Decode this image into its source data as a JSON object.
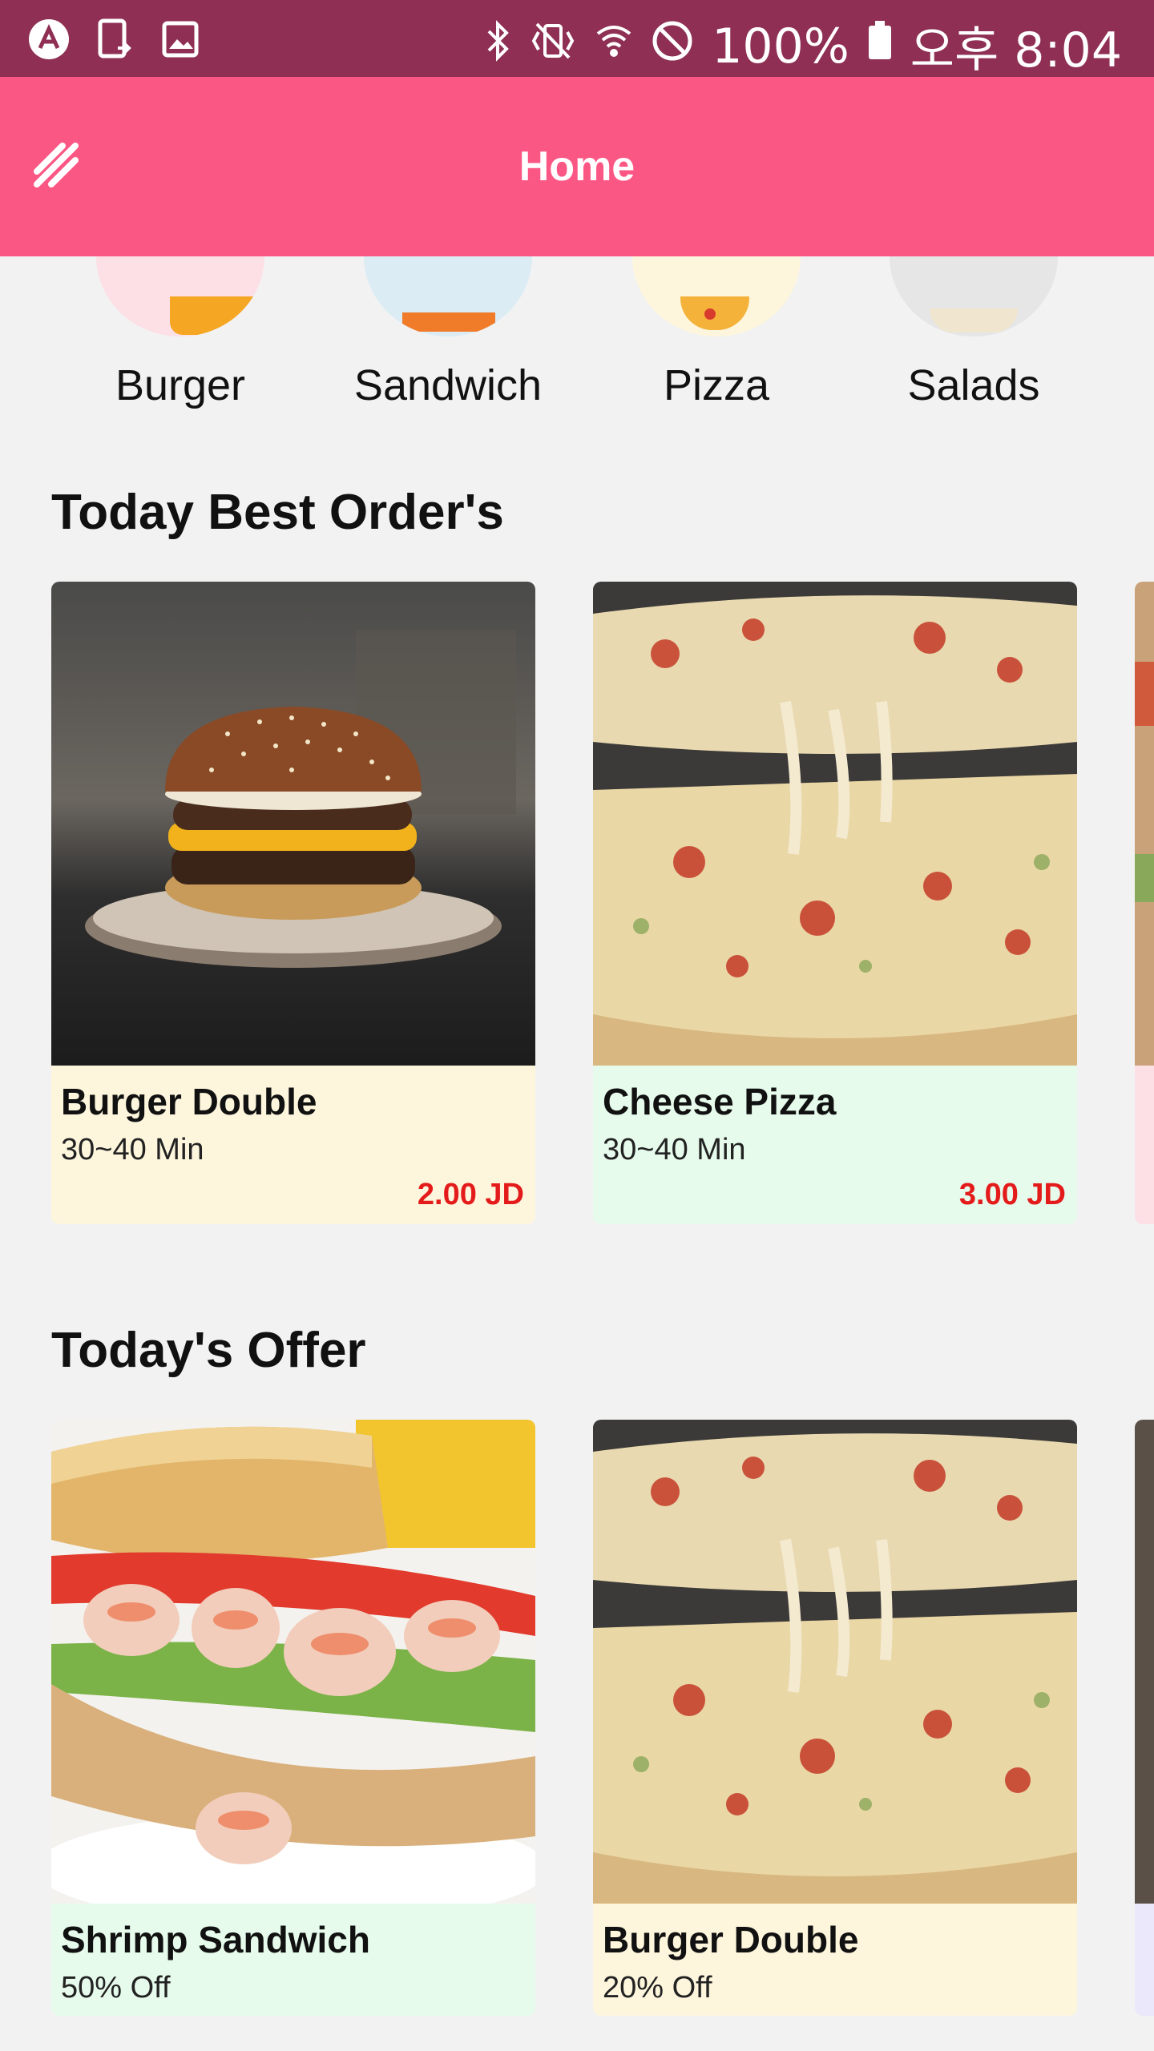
{
  "status_bar": {
    "left_icons": [
      "app-icon",
      "phone-transfer-icon",
      "image-icon"
    ],
    "right_icons": [
      "bluetooth-icon",
      "vibrate-icon",
      "wifi-icon",
      "do-not-disturb-icon",
      "battery-icon"
    ],
    "battery": "100%",
    "time": "오후 8:04"
  },
  "app_bar": {
    "title": "Home",
    "menu_icon": "menu-icon"
  },
  "categories": [
    {
      "label": "Burger",
      "color": "#fde0e6"
    },
    {
      "label": "Sandwich",
      "color": "#dcecf5"
    },
    {
      "label": "Pizza",
      "color": "#fdf5dc"
    },
    {
      "label": "Salads",
      "color": "#e6e6e6"
    }
  ],
  "best_orders": {
    "title": "Today Best Order's",
    "items": [
      {
        "name": "Burger Double",
        "time": "30~40 Min",
        "price": "2.00 JD",
        "bg": "#fdf5dc"
      },
      {
        "name": "Cheese Pizza",
        "time": "30~40 Min",
        "price": "3.00 JD",
        "bg": "#e6fbec"
      },
      {
        "name": "",
        "time": "",
        "price": "",
        "bg": "#fde0e6"
      }
    ]
  },
  "offers": {
    "title": "Today's Offer",
    "items": [
      {
        "name": "Shrimp Sandwich",
        "discount": "50% Off",
        "bg": "#e6fbec"
      },
      {
        "name": "Burger Double",
        "discount": "20% Off",
        "bg": "#fdf5dc"
      },
      {
        "name": "",
        "discount": "",
        "bg": "#ebe8fb"
      }
    ]
  },
  "colors": {
    "status_bar": "#8e2f53",
    "app_bar": "#fb5784",
    "price": "#e41b1b",
    "background": "#f2f2f2"
  }
}
